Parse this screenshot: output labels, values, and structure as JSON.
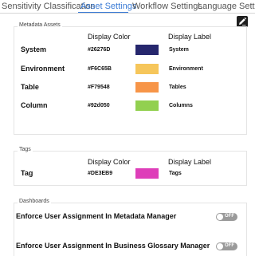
{
  "tabs": [
    {
      "label": "Sensitivity Classification",
      "active": false
    },
    {
      "label": "Asset Settings",
      "active": true
    },
    {
      "label": "Workflow Settings",
      "active": false
    },
    {
      "label": "Language Settings",
      "active": false
    }
  ],
  "toolbar": {
    "edit_icon": "edit-pencil-icon"
  },
  "metadata_assets": {
    "legend": "Metadata Assets",
    "col_color": "Display Color",
    "col_label": "Display Label",
    "rows": [
      {
        "name": "System",
        "hex": "#26276D",
        "color": "#26276D",
        "label": "System"
      },
      {
        "name": "Environment",
        "hex": "#F6C65B",
        "color": "#F6C65B",
        "label": "Environment"
      },
      {
        "name": "Table",
        "hex": "#F79548",
        "color": "#F79548",
        "label": "Tables"
      },
      {
        "name": "Column",
        "hex": "#92d050",
        "color": "#92d050",
        "label": "Columns"
      }
    ]
  },
  "tags": {
    "legend": "Tags",
    "col_color": "Display Color",
    "col_label": "Display Label",
    "rows": [
      {
        "name": "Tag",
        "hex": "#DE3EB9",
        "color": "#DE3EB9",
        "label": "Tags"
      }
    ]
  },
  "dashboards": {
    "legend": "Dashboards",
    "rows": [
      {
        "label": "Enforce User Assignment In Metadata Manager",
        "state": "OFF"
      },
      {
        "label": "Enforce User Assignment In Business Glossary Manager",
        "state": "OFF"
      }
    ]
  },
  "colors": {
    "accent": "#3a7bd5",
    "toggle_off": "#9a9a9a"
  }
}
